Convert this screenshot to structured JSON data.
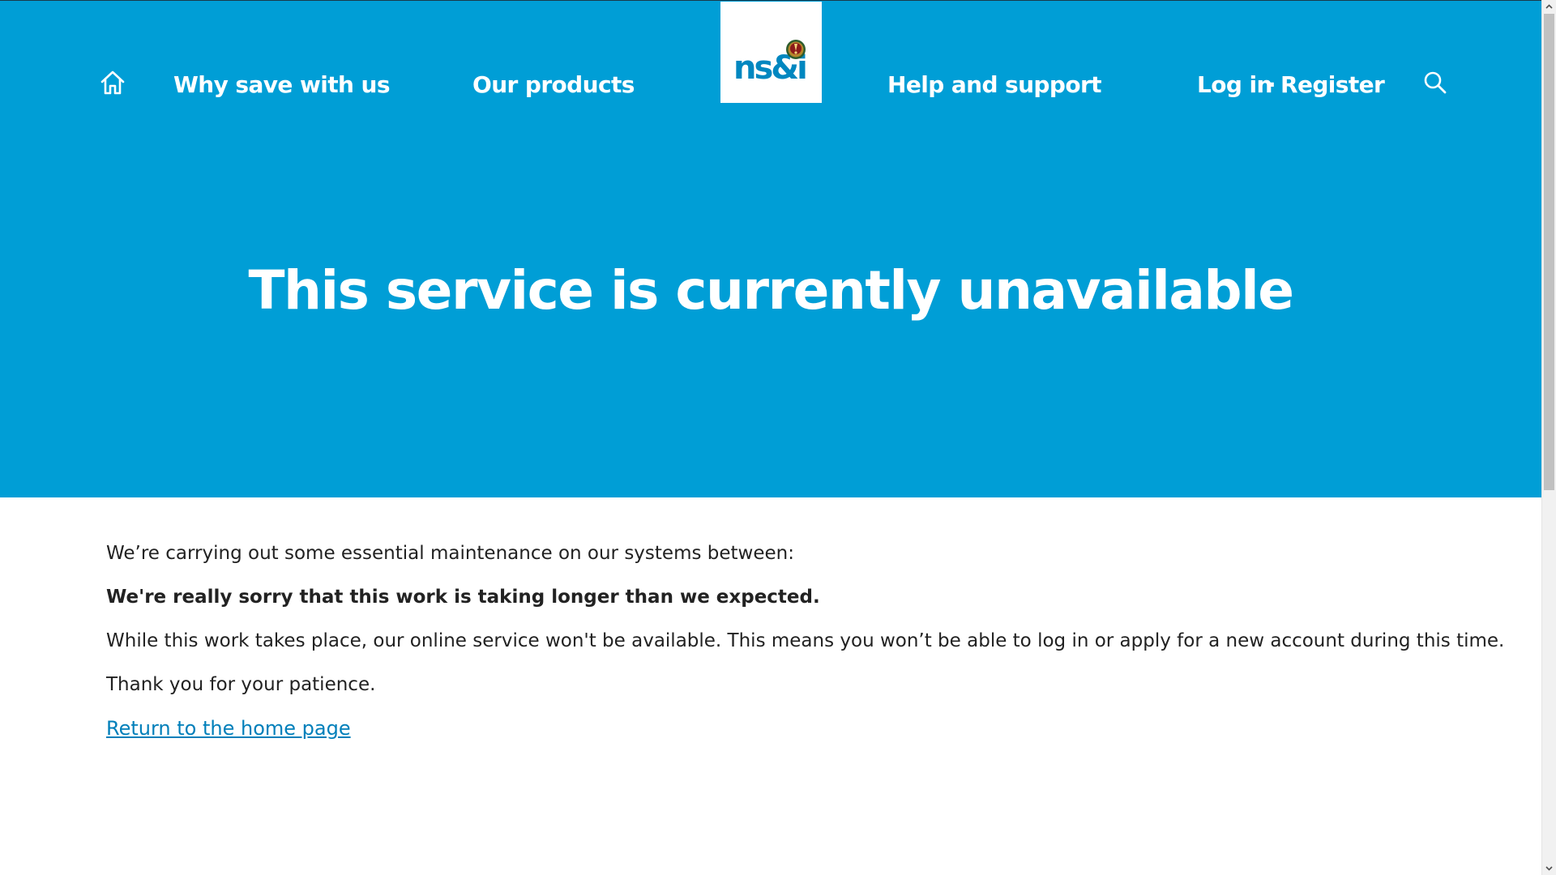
{
  "nav": {
    "home_icon": "home-icon",
    "why_save": "Why save with us",
    "our_products": "Our products",
    "logo_text": "ns&i",
    "help_support": "Help and support",
    "log_in": "Log in",
    "separator": "·",
    "register": "Register",
    "search_icon": "search-icon"
  },
  "hero": {
    "title": "This service is currently unavailable"
  },
  "content": {
    "intro": "We’re carrying out some essential maintenance on our systems between:",
    "apology": "We're really sorry that this work is taking longer than we expected.",
    "details": "While this work takes place, our online service won't be available. This means you won’t be able to log in or apply for a new account during this time.",
    "thanks": "Thank you for your patience.",
    "home_link": "Return to the home page"
  },
  "colors": {
    "brand_blue": "#009ed6",
    "link_blue": "#007fba",
    "text": "#222222",
    "white": "#ffffff"
  }
}
